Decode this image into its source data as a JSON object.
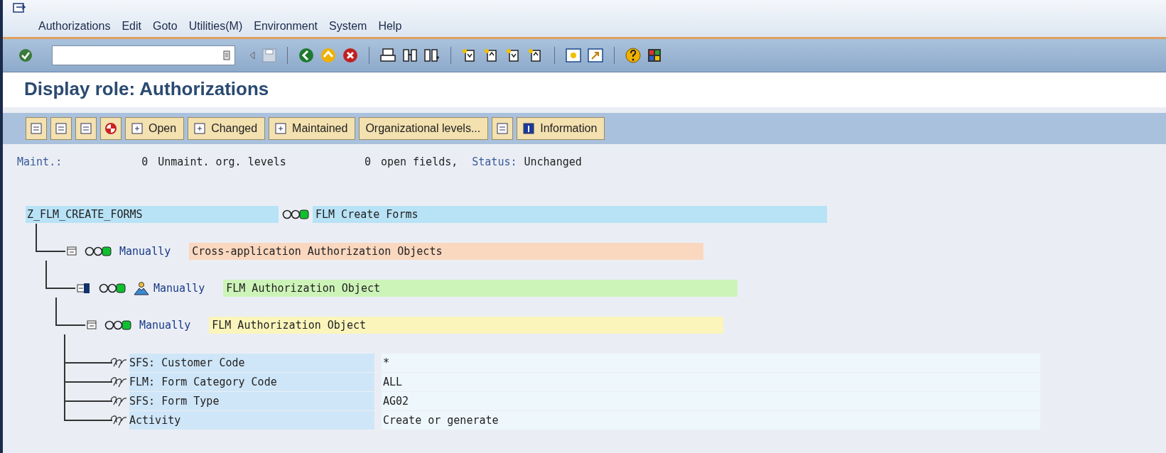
{
  "menu": [
    "Authorizations",
    "Edit",
    "Goto",
    "Utilities(M)",
    "Environment",
    "System",
    "Help"
  ],
  "title": "Display role: Authorizations",
  "app_toolbar": [
    {
      "kind": "icon"
    },
    {
      "kind": "icon"
    },
    {
      "kind": "icon"
    },
    {
      "kind": "icon"
    },
    {
      "kind": "icon-text",
      "label": "Open"
    },
    {
      "kind": "icon-text",
      "label": "Changed"
    },
    {
      "kind": "icon-text",
      "label": "Maintained"
    },
    {
      "kind": "text",
      "label": "Organizational levels..."
    },
    {
      "kind": "icon"
    },
    {
      "kind": "icon-text",
      "label": "Information"
    }
  ],
  "status_line": {
    "maint_label": "Maint.:",
    "unmaint_count": "0",
    "unmaint_label": "Unmaint. org. levels",
    "open_count": "0",
    "open_label": "open fields,",
    "status_label": "Status:",
    "status_value": "Unchanged"
  },
  "tree": {
    "id": "Z_FLM_CREATE_FORMS",
    "green": true,
    "text": "FLM Create Forms",
    "color": "#b8e2f6",
    "children": [
      {
        "origin": "Manually",
        "green": true,
        "text": "Cross-application Authorization Objects",
        "color": "#fad7bf",
        "children": [
          {
            "origin": "Manually",
            "green": true,
            "text": "FLM Authorization Object",
            "color": "#cdf4b8",
            "children": [
              {
                "origin": "Manually",
                "green": true,
                "text": "FLM Authorization Object",
                "color": "#fbf5bc",
                "fields": [
                  {
                    "name": "SFS: Customer Code",
                    "value": "*"
                  },
                  {
                    "name": "FLM: Form Category Code",
                    "value": "ALL"
                  },
                  {
                    "name": "SFS: Form Type",
                    "value": "AG02"
                  },
                  {
                    "name": "Activity",
                    "value": "Create or generate"
                  }
                ]
              }
            ]
          }
        ]
      }
    ]
  }
}
